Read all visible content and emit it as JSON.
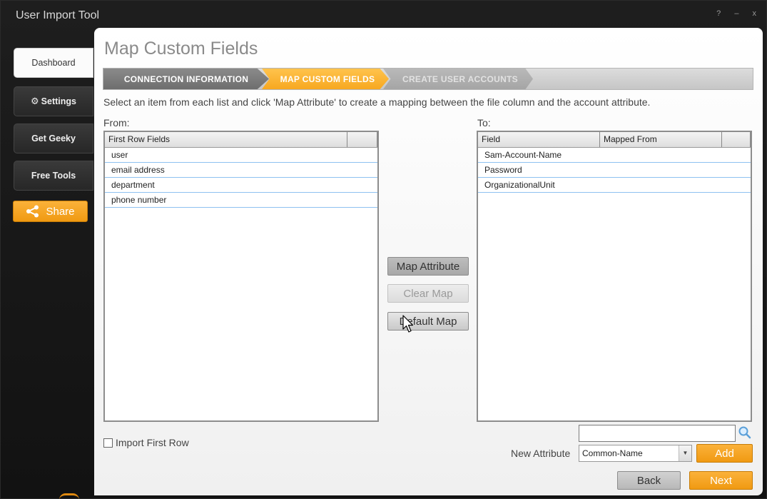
{
  "window": {
    "title": "User Import Tool",
    "controls": "? – x"
  },
  "sidebar": {
    "items": [
      {
        "label": "Dashboard"
      },
      {
        "label": "Settings"
      },
      {
        "label": "Get Geeky"
      },
      {
        "label": "Free Tools"
      }
    ],
    "share_label": "Share"
  },
  "page": {
    "title": "Map Custom Fields",
    "steps": [
      {
        "label": "CONNECTION INFORMATION",
        "state": "completed"
      },
      {
        "label": "MAP CUSTOM FIELDS",
        "state": "active"
      },
      {
        "label": "CREATE USER ACCOUNTS",
        "state": "pending"
      }
    ],
    "instructions": "Select an item from each list and click 'Map Attribute' to create a mapping between the file column and the account attribute."
  },
  "from_list": {
    "label": "From:",
    "columns": [
      "First Row Fields",
      ""
    ],
    "rows": [
      "user",
      "email address",
      "department",
      "phone number"
    ]
  },
  "to_list": {
    "label": "To:",
    "columns": [
      "Field",
      "Mapped From",
      ""
    ],
    "rows": [
      {
        "field": "Sam-Account-Name",
        "mapped_from": ""
      },
      {
        "field": "Password",
        "mapped_from": ""
      },
      {
        "field": "OrganizationalUnit",
        "mapped_from": ""
      }
    ]
  },
  "actions": {
    "map_attribute": "Map Attribute",
    "clear_map": "Clear Map",
    "default_map": "Default Map"
  },
  "options": {
    "import_first_row_label": "Import First Row",
    "import_first_row_checked": false
  },
  "new_attribute": {
    "search_value": "",
    "label": "New Attribute",
    "selected": "Common-Name",
    "add_label": "Add"
  },
  "footer": {
    "back_label": "Back",
    "next_label": "Next"
  },
  "colors": {
    "accent": "#f7a820",
    "panel": "#f5f5f5",
    "frame": "#1a1a1a"
  }
}
